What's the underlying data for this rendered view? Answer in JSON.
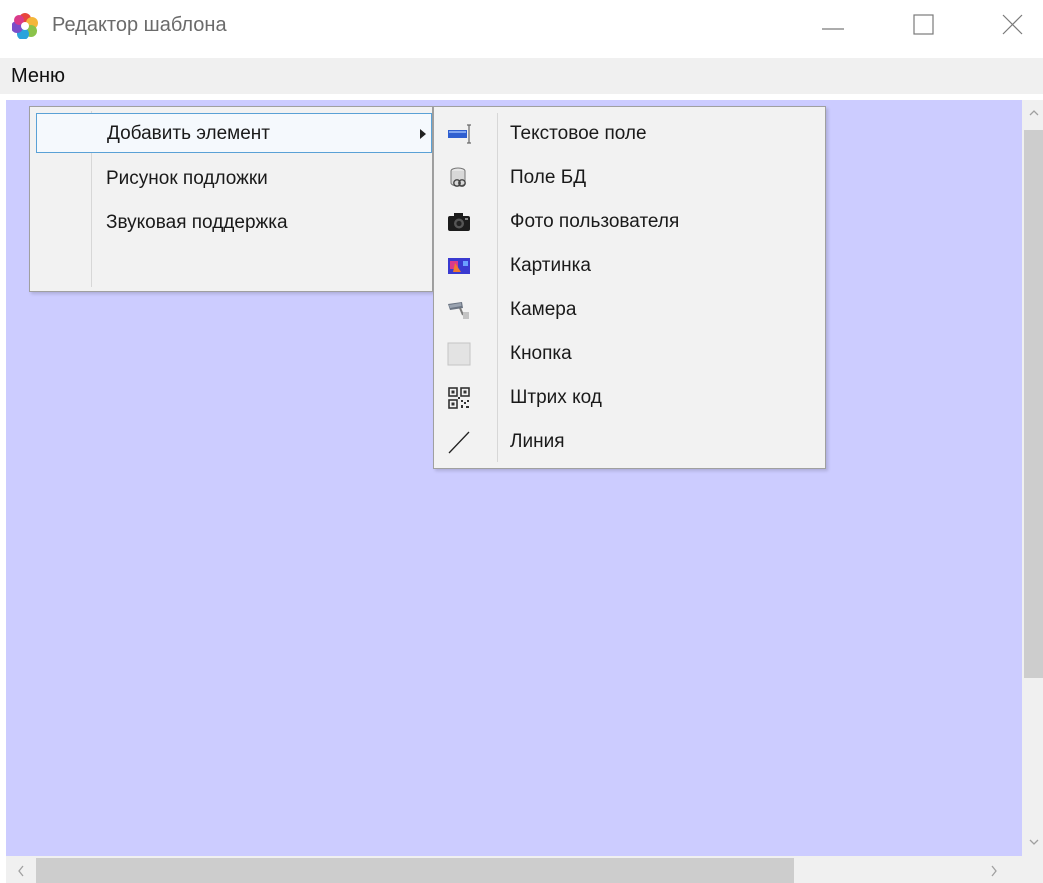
{
  "window": {
    "title": "Редактор шаблона",
    "icon": "app-logo-icon"
  },
  "menubar": {
    "menu_label": "Меню"
  },
  "context_menu": {
    "items": [
      {
        "label": "Добавить элемент",
        "has_submenu": true,
        "highlighted": true
      },
      {
        "label": "Рисунок подложки"
      },
      {
        "label": "Звуковая поддержка"
      }
    ]
  },
  "submenu": {
    "items": [
      {
        "label": "Текстовое поле",
        "icon": "text-field-icon"
      },
      {
        "label": "Поле БД",
        "icon": "database-field-icon"
      },
      {
        "label": "Фото пользователя",
        "icon": "camera-photo-icon"
      },
      {
        "label": "Картинка",
        "icon": "picture-icon"
      },
      {
        "label": "Камера",
        "icon": "cctv-camera-icon"
      },
      {
        "label": "Кнопка",
        "icon": "button-icon"
      },
      {
        "label": "Штрих код",
        "icon": "qr-code-icon"
      },
      {
        "label": "Линия",
        "icon": "line-icon"
      }
    ]
  },
  "colors": {
    "canvas_background": "#ccccff",
    "menu_highlight_border": "#5aa1d6"
  }
}
